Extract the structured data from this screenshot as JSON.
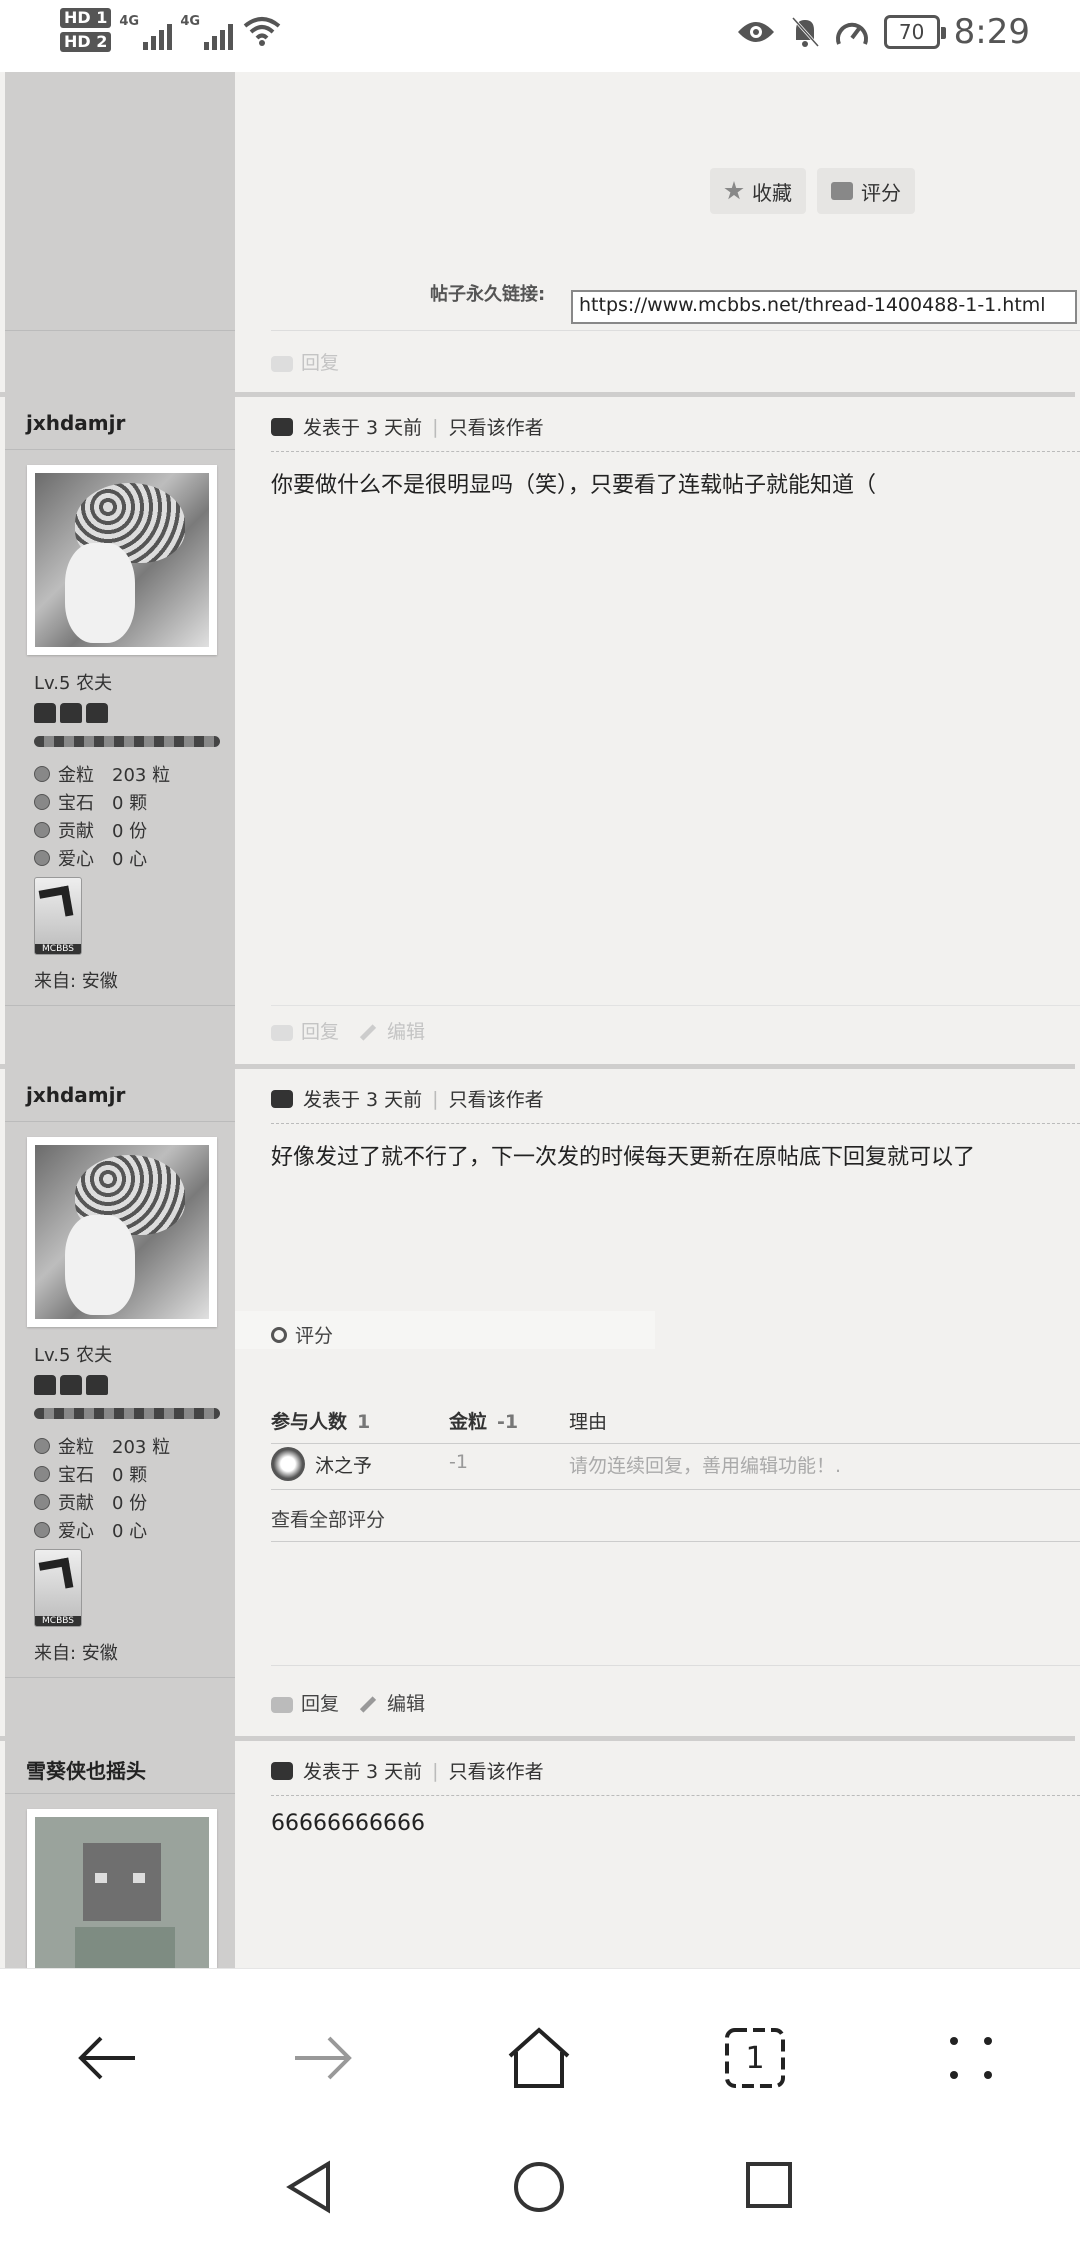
{
  "status_bar": {
    "hd1": "HD 1",
    "hd2": "HD 2",
    "net1": "4G",
    "net2": "4G",
    "battery": "70",
    "time": "8:29"
  },
  "top_section": {
    "favorite_label": "收藏",
    "rate_label": "评分",
    "permalink_label": "帖子永久链接:",
    "permalink_url": "https://www.mcbbs.net/thread-1400488-1-1.html",
    "reply_label": "回复"
  },
  "posts": [
    {
      "author": "jxhdamjr",
      "level": "Lv.5 农夫",
      "stats": [
        {
          "label": "金粒",
          "value": "203 粒"
        },
        {
          "label": "宝石",
          "value": "0 颗"
        },
        {
          "label": "贡献",
          "value": "0 份"
        },
        {
          "label": "爱心",
          "value": "0 心"
        }
      ],
      "badge_text": "MCBBS",
      "from": "来自:  安徽",
      "posted": "发表于 3 天前",
      "only_author": "只看该作者",
      "content": "你要做什么不是很明显吗（笑），只要看了连载帖子就能知道（",
      "reply": "回复",
      "edit": "编辑"
    },
    {
      "author": "jxhdamjr",
      "level": "Lv.5 农夫",
      "stats": [
        {
          "label": "金粒",
          "value": "203 粒"
        },
        {
          "label": "宝石",
          "value": "0 颗"
        },
        {
          "label": "贡献",
          "value": "0 份"
        },
        {
          "label": "爱心",
          "value": "0 心"
        }
      ],
      "badge_text": "MCBBS",
      "from": "来自:  安徽",
      "posted": "发表于 3 天前",
      "only_author": "只看该作者",
      "content": "好像发过了就不行了，下一次发的时候每天更新在原帖底下回复就可以了",
      "rating": {
        "title": "评分",
        "participants_label": "参与人数",
        "participants": "1",
        "gold_label": "金粒",
        "gold": "-1",
        "reason_label": "理由",
        "rows": [
          {
            "user": "沐之予",
            "gold": "-1",
            "reason": "请勿连续回复，善用编辑功能！."
          }
        ],
        "view_all": "查看全部评分"
      },
      "reply": "回复",
      "edit": "编辑"
    },
    {
      "author": "雪葵侠也摇头",
      "posted": "发表于 3 天前",
      "only_author": "只看该作者",
      "content": "66666666666"
    }
  ],
  "nav": {
    "tab_count": "1"
  }
}
